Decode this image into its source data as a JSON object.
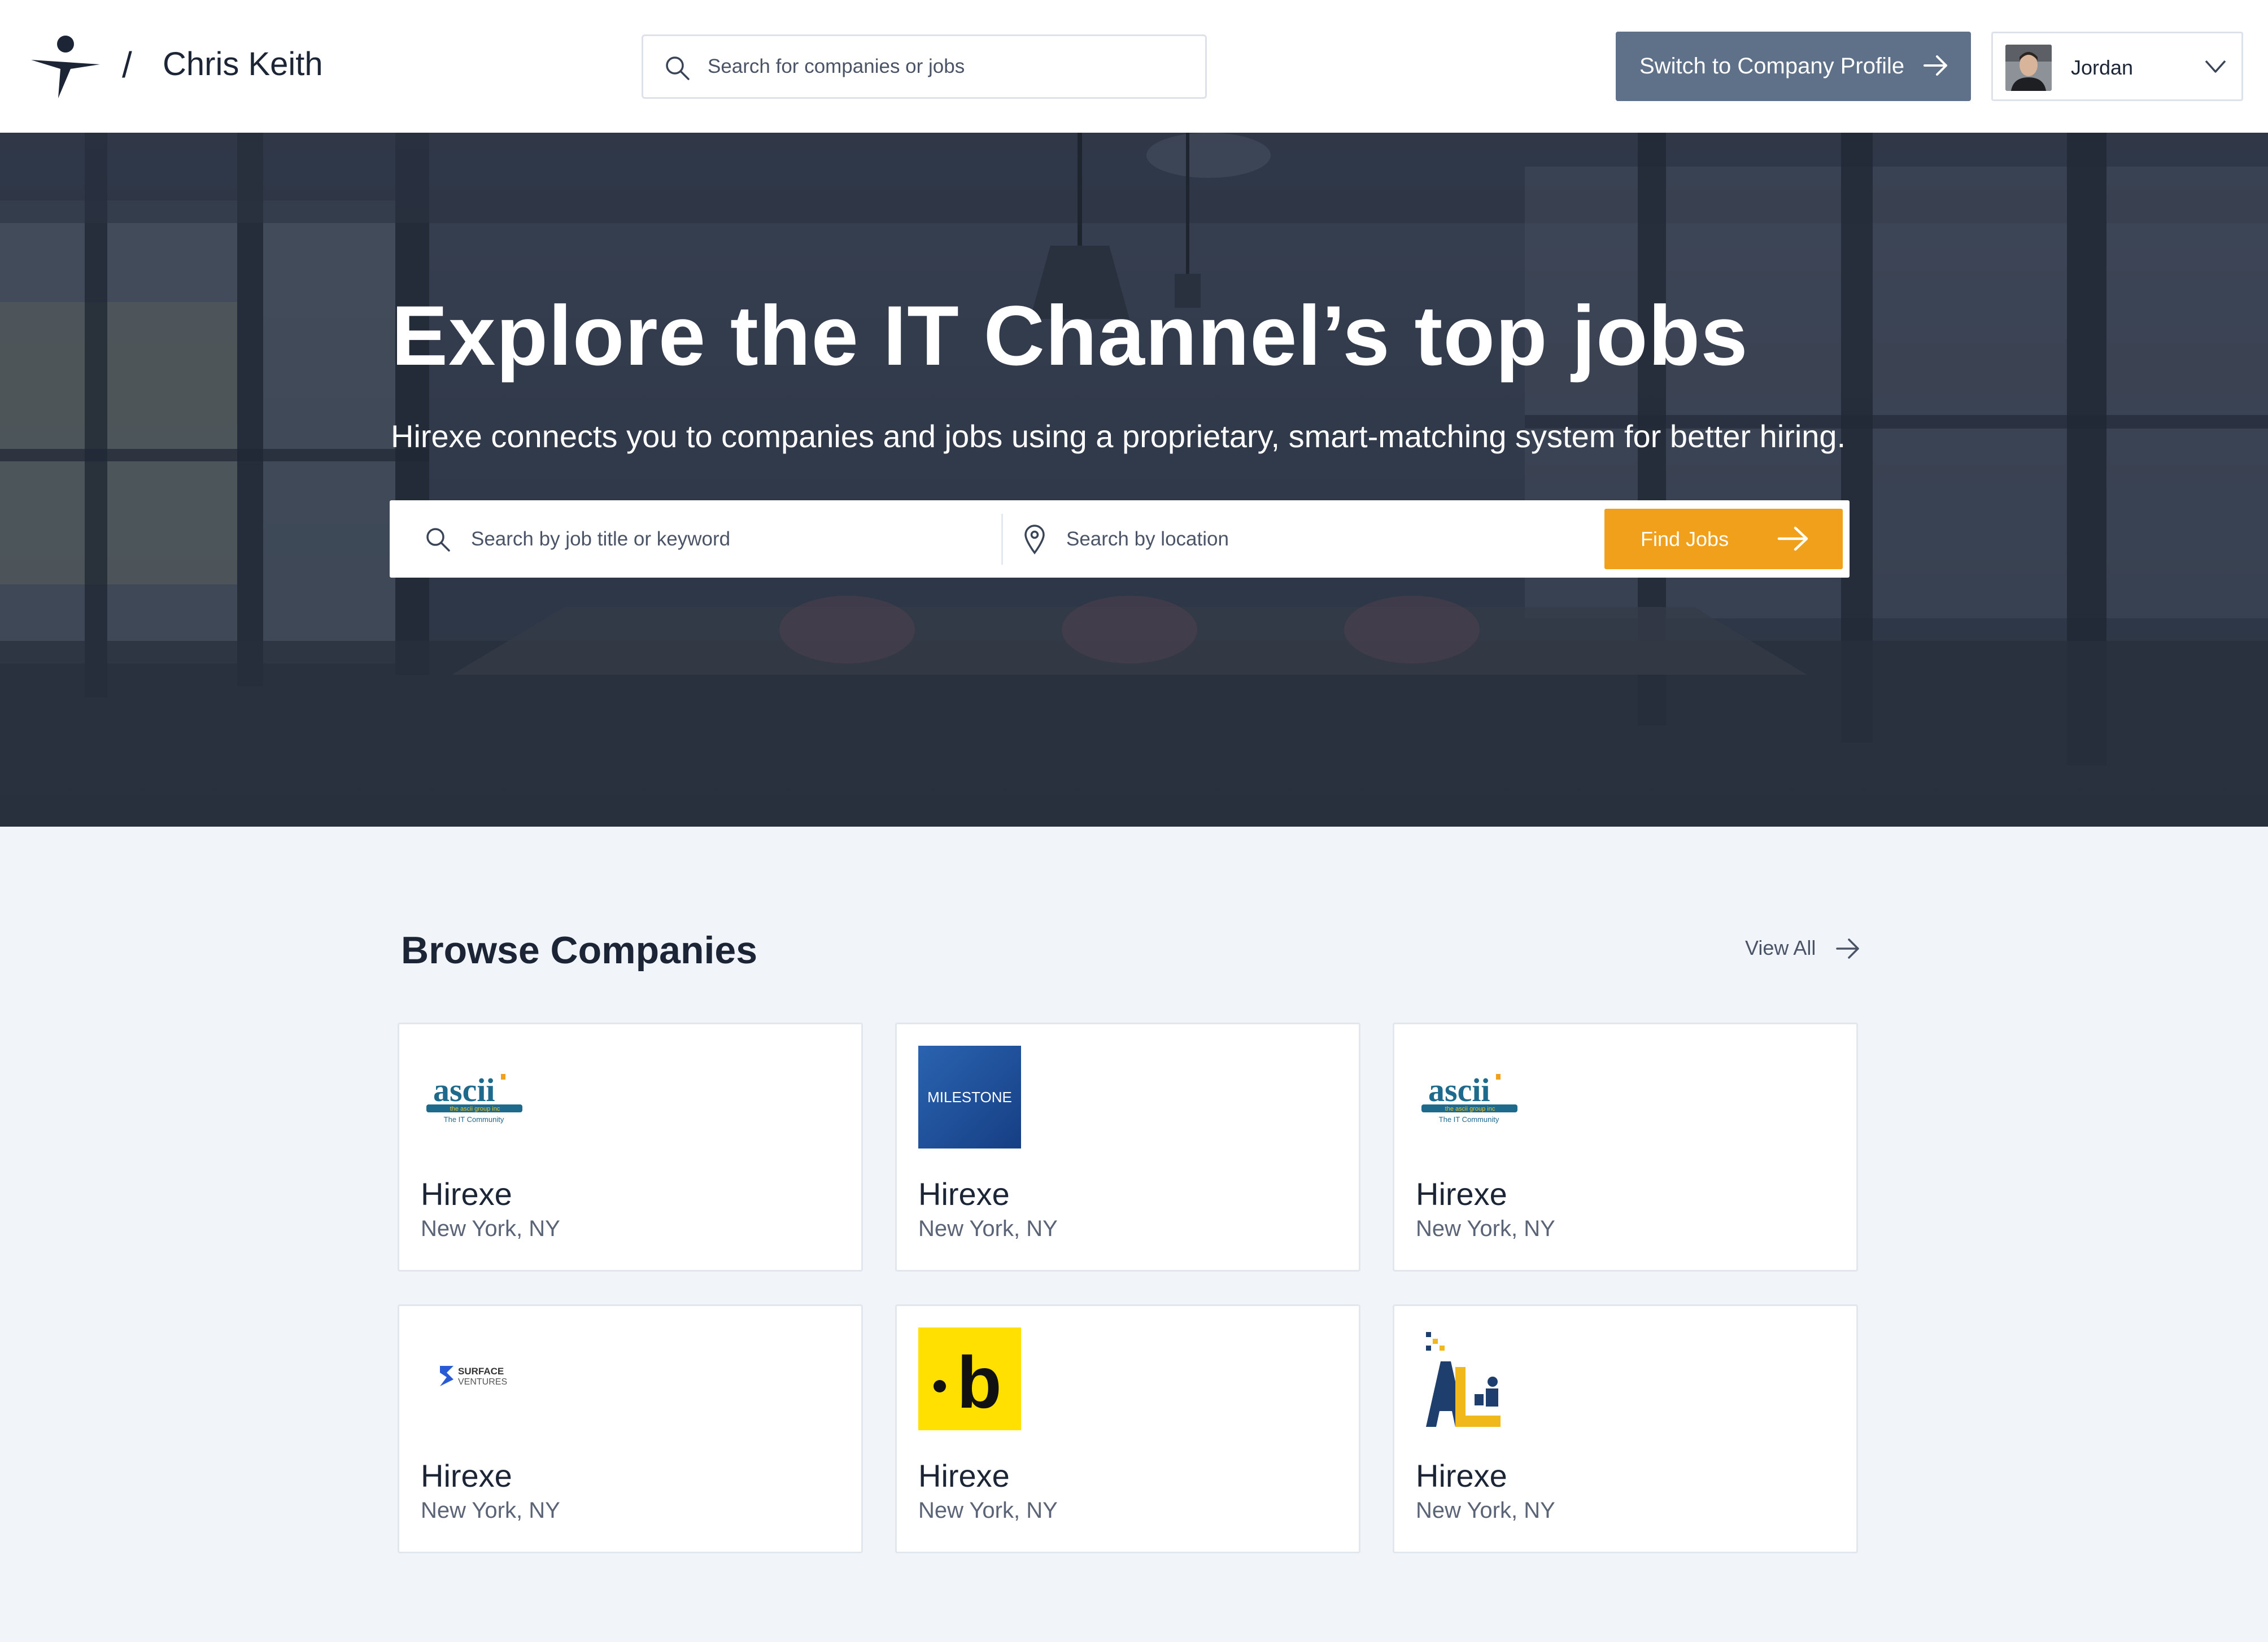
{
  "header": {
    "brand_separator": "/",
    "brand_name": "Chris Keith",
    "search_placeholder": "Search for companies or jobs",
    "switch_label": "Switch to Company Profile",
    "user_name": "Jordan"
  },
  "hero": {
    "title": "Explore the IT Channel’s top jobs",
    "subtitle": "Hirexe connects you to companies and jobs using a proprietary, smart-matching system for better hiring.",
    "keyword_placeholder": "Search by job title or keyword",
    "location_placeholder": "Search by location",
    "find_label": "Find Jobs"
  },
  "browse": {
    "title": "Browse Companies",
    "view_all": "View All",
    "companies": [
      {
        "name": "Hirexe",
        "location": "New York, NY",
        "logo": "ascii-logo",
        "logo_text": "ascii",
        "logo_subtext": "the ascii group inc",
        "logo_tagline": "The IT Community"
      },
      {
        "name": "Hirexe",
        "location": "New York, NY",
        "logo": "milestone-logo",
        "logo_text": "MILESTONE"
      },
      {
        "name": "Hirexe",
        "location": "New York, NY",
        "logo": "ascii-logo",
        "logo_text": "ascii",
        "logo_subtext": "the ascii group inc",
        "logo_tagline": "The IT Community"
      },
      {
        "name": "Hirexe",
        "location": "New York, NY",
        "logo": "surface-ventures-logo",
        "logo_text": "SURFACE",
        "logo_subtext": "VENTURES"
      },
      {
        "name": "Hirexe",
        "location": "New York, NY",
        "logo": "b-logo",
        "logo_text": "b"
      },
      {
        "name": "Hirexe",
        "location": "New York, NY",
        "logo": "al-logo",
        "logo_text": "AL"
      }
    ]
  },
  "colors": {
    "accent": "#f0a01a",
    "switch_button": "#5f7189",
    "navy": "#1c2536",
    "page_bg": "#f1f4f8"
  }
}
